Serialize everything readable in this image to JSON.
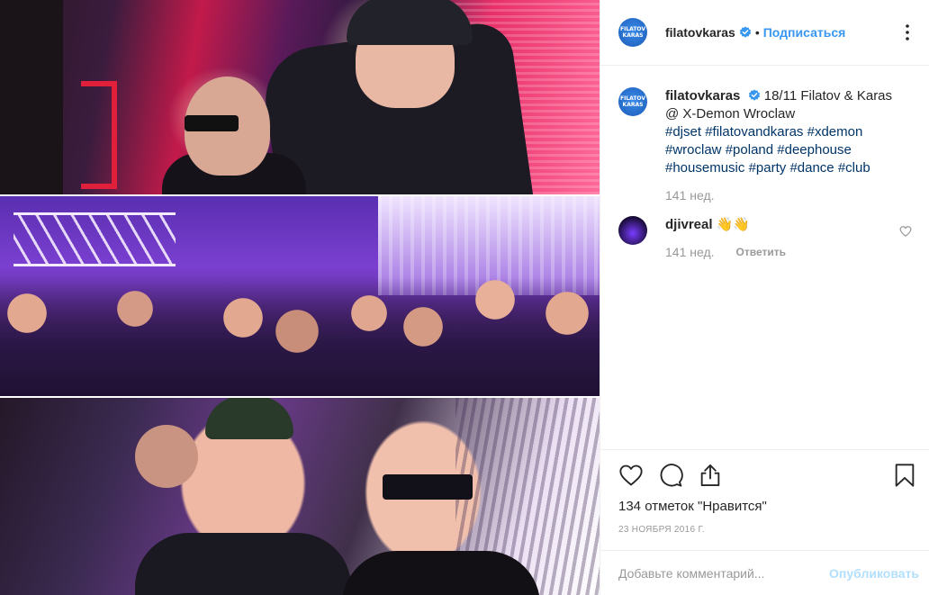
{
  "post": {
    "author": "filatovkaras",
    "avatar_text": "FILATOV KARAS",
    "separator": "•",
    "follow_label": "Подписаться",
    "caption": {
      "text": "18/11 Filatov & Karas @ X-Demon Wroclaw",
      "hashtags": [
        "#djset",
        "#filatovandkaras",
        "#xdemon",
        "#wroclaw",
        "#poland",
        "#deephouse",
        "#housemusic",
        "#party",
        "#dance",
        "#club"
      ],
      "age": "141 нед."
    },
    "comments": [
      {
        "user": "djivreal",
        "text": "👋👋",
        "age": "141 нед.",
        "reply_label": "Ответить"
      }
    ],
    "likes_text": "134 отметок \"Нравится\"",
    "date": "23 ноября 2016 г.",
    "comment_placeholder": "Добавьте комментарий...",
    "publish_label": "Опубликовать"
  },
  "icons": {
    "more": "more-options-icon",
    "verified": "verified-badge-icon",
    "like": "heart-icon",
    "comment": "comment-icon",
    "share": "share-icon",
    "save": "bookmark-icon"
  },
  "colors": {
    "link": "#3897f0",
    "hashtag": "#003569",
    "muted": "#999999",
    "publish_disabled": "#b2dffc",
    "border": "#efefef"
  }
}
